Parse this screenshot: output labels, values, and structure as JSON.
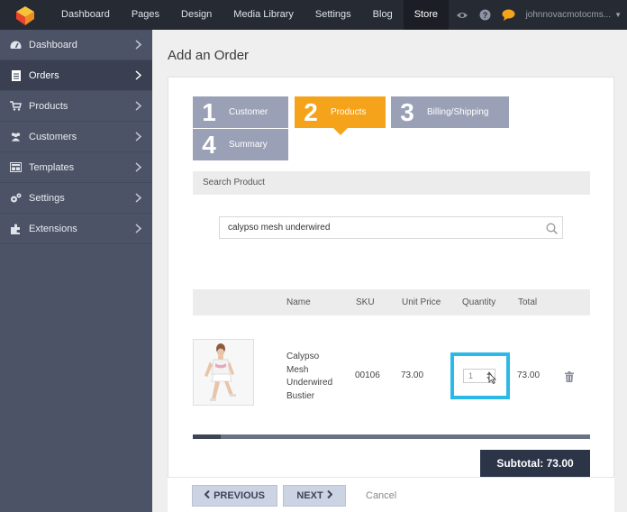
{
  "topbar": {
    "nav": [
      "Dashboard",
      "Pages",
      "Design",
      "Media Library",
      "Settings",
      "Blog",
      "Store"
    ],
    "active": "Store",
    "username": "johnnovacmotocms...",
    "icons": [
      "eye-icon",
      "help-icon",
      "chat-icon"
    ]
  },
  "sidebar": {
    "items": [
      {
        "label": "Dashboard",
        "icon": "gauge-icon"
      },
      {
        "label": "Orders",
        "icon": "document-icon"
      },
      {
        "label": "Products",
        "icon": "cart-icon"
      },
      {
        "label": "Customers",
        "icon": "users-icon"
      },
      {
        "label": "Templates",
        "icon": "template-icon"
      },
      {
        "label": "Settings",
        "icon": "gears-icon"
      },
      {
        "label": "Extensions",
        "icon": "puzzle-icon"
      }
    ],
    "active": "Orders"
  },
  "main": {
    "title": "Add an Order",
    "steps": [
      {
        "num": "1",
        "label": "Customer"
      },
      {
        "num": "2",
        "label": "Products"
      },
      {
        "num": "3",
        "label": "Billing/Shipping"
      },
      {
        "num": "4",
        "label": "Summary"
      }
    ],
    "active_step": "Products",
    "search_label": "Search Product",
    "search_value": "calypso mesh underwired",
    "table": {
      "headers": [
        "Name",
        "SKU",
        "Unit Price",
        "Quantity",
        "Total"
      ],
      "row": {
        "name_lines": [
          "Calypso",
          "Mesh",
          "Underwired",
          "Bustier"
        ],
        "sku": "00106",
        "unit_price": "73.00",
        "quantity": "1",
        "total": "73.00"
      }
    },
    "scroll_position": 0.07,
    "subtotal": "Subtotal: 73.00",
    "buttons": {
      "previous": "PREVIOUS",
      "next": "NEXT",
      "cancel": "Cancel"
    }
  },
  "colors": {
    "topbar": "#262a33",
    "sidebar": "#4c5366",
    "step_active": "#f5a31a",
    "step_inactive": "#9aa1b6",
    "highlight": "#2cb9e8",
    "subtotal": "#2c3448"
  }
}
